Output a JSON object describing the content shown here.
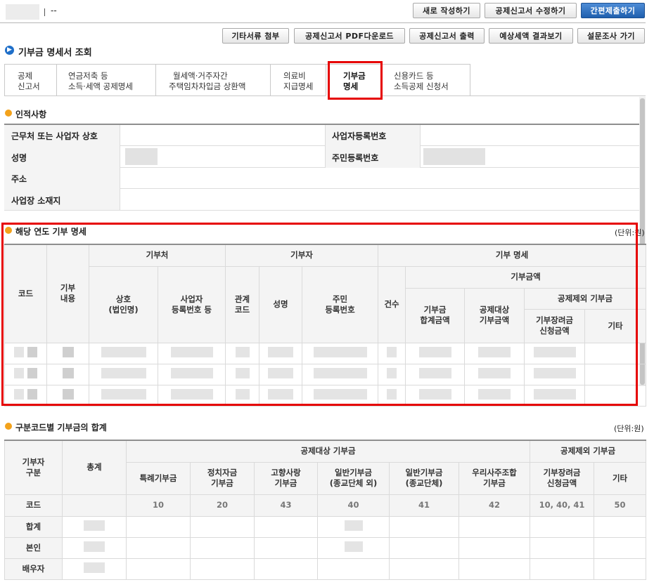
{
  "topbar": {
    "title_suffix": "--",
    "buttons": {
      "new": "새로 작성하기",
      "edit": "공제신고서 수정하기",
      "submit": "간편제출하기"
    }
  },
  "toolbar": {
    "attach": "기타서류 첨부",
    "pdf": "공제신고서 PDF다운로드",
    "print": "공제신고서 출력",
    "estimate": "예상세액 결과보기",
    "survey": "설문조사 가기"
  },
  "page_title": "기부금 명세서 조회",
  "tabs": [
    {
      "line1": "공제",
      "line2": "신고서"
    },
    {
      "line1": "연금저축 등",
      "line2": "소득·세액 공제명세"
    },
    {
      "line1": "월세액·거주자간",
      "line2": "주택임차차입금 상환액"
    },
    {
      "line1": "의료비",
      "line2": "지급명세"
    },
    {
      "line1": "기부금",
      "line2": "명세"
    },
    {
      "line1": "신용카드 등",
      "line2": "소득공제 신청서"
    }
  ],
  "personal": {
    "title": "인적사항",
    "employer_label": "근무처 또는 사업자 상호",
    "biz_no_label": "사업자등록번호",
    "name_label": "성명",
    "rrn_label": "주민등록번호",
    "address_label": "주소",
    "biz_address_label": "사업장 소재지"
  },
  "donation_detail": {
    "title": "해당 연도 기부 명세",
    "unit": "(단위:원)",
    "headers": {
      "code": "코드",
      "content": "기부\n내용",
      "recipient": "기부처",
      "recipient_name": "상호\n(법인명)",
      "recipient_biz_no": "사업자\n등록번호 등",
      "donor": "기부자",
      "relation": "관계\n코드",
      "donor_name": "성명",
      "donor_rrn": "주민\n등록번호",
      "detail": "기부 명세",
      "count": "건수",
      "amount": "기부금액",
      "total": "기부금\n합계금액",
      "deductible": "공제대상\n기부금액",
      "non_deductible": "공제제외 기부금",
      "scholarship": "기부장려금\n신청금액",
      "other": "기타"
    }
  },
  "code_summary": {
    "title": "구분코드별 기부금의 합계",
    "unit": "(단위:원)",
    "headers": {
      "donor_type": "기부자\n구분",
      "total": "총계",
      "deductible": "공제대상 기부금",
      "non_deductible": "공제제외 기부금",
      "special": "특례기부금",
      "political": "정치자금\n기부금",
      "hometown": "고향사랑\n기부금",
      "general_non_religious": "일반기부금\n(종교단체 외)",
      "general_religious": "일반기부금\n(종교단체)",
      "esop": "우리사주조합\n기부금",
      "scholarship": "기부장려금\n신청금액",
      "other": "기타"
    },
    "rows": {
      "code": "코드",
      "sum": "합계",
      "self": "본인",
      "spouse": "배우자"
    },
    "codes": [
      "10",
      "20",
      "43",
      "40",
      "41",
      "42",
      "10, 40, 41",
      "50"
    ]
  },
  "colors": {
    "highlight": "#e60000",
    "primary_button": "#2a6bbd",
    "section_icon": "#f3a21b",
    "title_icon": "#1f6fc9"
  }
}
